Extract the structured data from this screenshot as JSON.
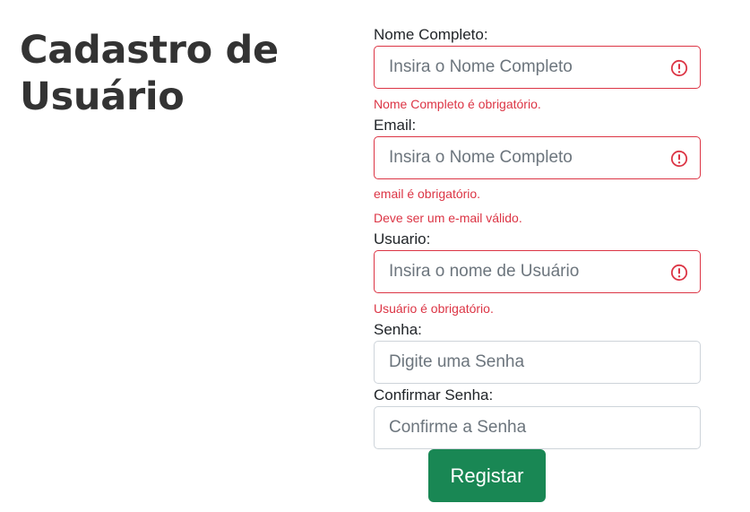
{
  "page": {
    "title": "Cadastro de Usuário"
  },
  "colors": {
    "invalid": "#dc3545",
    "primary_button": "#198754",
    "border": "#ced4da"
  },
  "form": {
    "fields": [
      {
        "label": "Nome Completo:",
        "placeholder": "Insira o Nome Completo",
        "value": "",
        "invalid": true,
        "icon": "error-icon",
        "errors": [
          "Nome Completo é obrigatório."
        ]
      },
      {
        "label": "Email:",
        "placeholder": "Insira o Nome Completo",
        "value": "",
        "invalid": true,
        "icon": "error-icon",
        "errors": [
          "email é obrigatório.",
          "Deve ser um e-mail válido."
        ]
      },
      {
        "label": "Usuario:",
        "placeholder": "Insira o nome de Usuário",
        "value": "",
        "invalid": true,
        "icon": "error-icon",
        "errors": [
          "Usuário é obrigatório."
        ]
      },
      {
        "label": "Senha:",
        "placeholder": "Digite uma Senha",
        "value": "",
        "invalid": false
      },
      {
        "label": "Confirmar Senha:",
        "placeholder": "Confirme a Senha",
        "value": "",
        "invalid": false
      }
    ],
    "submit_label": "Registar"
  }
}
